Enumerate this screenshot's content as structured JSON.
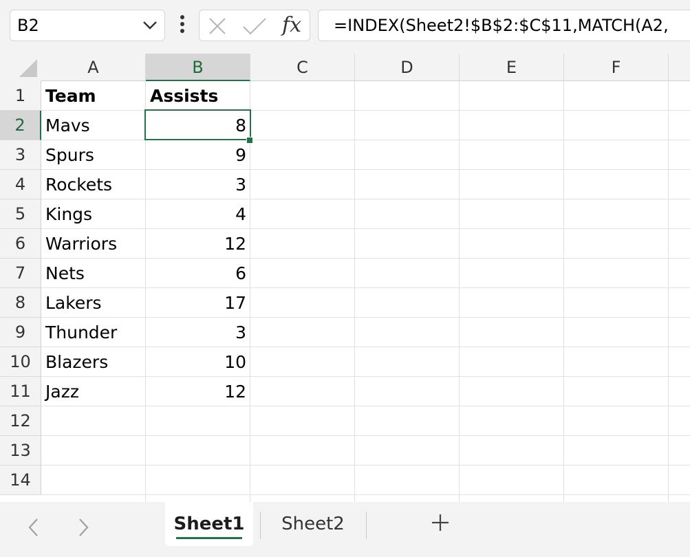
{
  "formula_bar": {
    "name_box": "B2",
    "fx_label": "fx",
    "formula": "=INDEX(Sheet2!$B$2:$C$11,MATCH(A2,"
  },
  "columns": [
    "A",
    "B",
    "C",
    "D",
    "E",
    "F"
  ],
  "selected_column": "B",
  "row_numbers": [
    "1",
    "2",
    "3",
    "4",
    "5",
    "6",
    "7",
    "8",
    "9",
    "10",
    "11",
    "12",
    "13",
    "14"
  ],
  "selected_row": "2",
  "table": {
    "headers": {
      "team": "Team",
      "assists": "Assists"
    },
    "rows": [
      {
        "team": "Mavs",
        "assists": "8"
      },
      {
        "team": "Spurs",
        "assists": "9"
      },
      {
        "team": "Rockets",
        "assists": "3"
      },
      {
        "team": "Kings",
        "assists": "4"
      },
      {
        "team": "Warriors",
        "assists": "12"
      },
      {
        "team": "Nets",
        "assists": "6"
      },
      {
        "team": "Lakers",
        "assists": "17"
      },
      {
        "team": "Thunder",
        "assists": "3"
      },
      {
        "team": "Blazers",
        "assists": "10"
      },
      {
        "team": "Jazz",
        "assists": "12"
      }
    ]
  },
  "sheet_tabs": {
    "sheet1": "Sheet1",
    "sheet2": "Sheet2",
    "active": "Sheet1"
  },
  "colors": {
    "accent": "#217346",
    "header_bg": "#f3f3f3",
    "selected_header_bg": "#d6d6d6"
  }
}
